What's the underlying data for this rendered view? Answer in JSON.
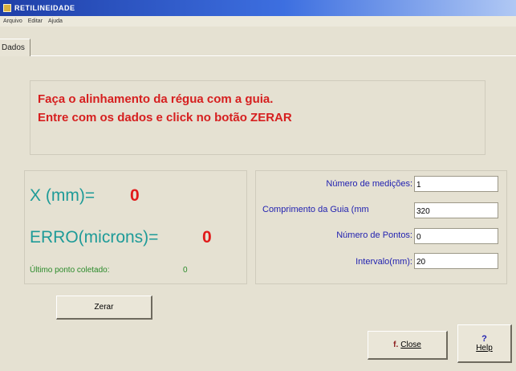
{
  "window": {
    "title": "RETILINEIDADE"
  },
  "menu": {
    "items": [
      "Arquivo",
      "Editar",
      "Ajuda"
    ]
  },
  "tabs": [
    {
      "label": "Dados"
    }
  ],
  "instructions": {
    "line1": "Faça o alinhamento da régua com a guia.",
    "line2": "Entre com os dados e click no botão ZERAR"
  },
  "readout": {
    "x_label": "X (mm)=",
    "x_value": "0",
    "erro_label": "ERRO(microns)=",
    "erro_value": "0",
    "ultimo_label": "Último ponto coletado:",
    "ultimo_value": "0"
  },
  "form": {
    "fields": [
      {
        "label": "Número de medições:",
        "value": "1"
      },
      {
        "label": "Comprimento da Guia (mm",
        "value": "320"
      },
      {
        "label": "Número de Pontos:",
        "value": "0"
      },
      {
        "label": "Intervalo(mm):",
        "value": "20"
      }
    ]
  },
  "buttons": {
    "zerar": "Zerar",
    "close_icon": "f.",
    "close_label": "Close",
    "help_icon": "?",
    "help_label": "Help"
  },
  "colors": {
    "title_bar": "#1f3fa8",
    "instruction_text": "#d61f1f",
    "readout_label": "#1e9b98",
    "readout_value": "#e11a1a",
    "status_text": "#2a8a2a",
    "field_label": "#1f1fb0"
  }
}
